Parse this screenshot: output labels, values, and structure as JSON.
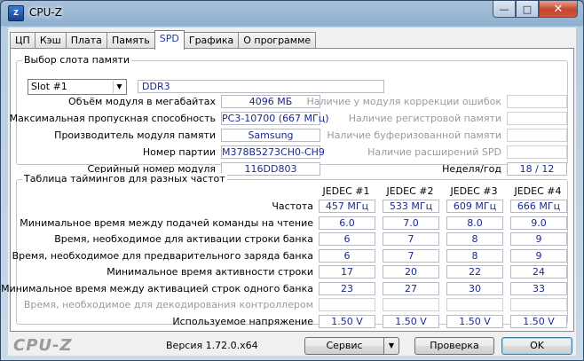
{
  "window": {
    "title": "CPU-Z",
    "app_icon_text": "Z",
    "buttons": {
      "minimize": "—",
      "maximize": "□",
      "close": "✕"
    }
  },
  "tabs": [
    "ЦП",
    "Кэш",
    "Плата",
    "Память",
    "SPD",
    "Графика",
    "О программе"
  ],
  "active_tab": "SPD",
  "slot_group": {
    "title": "Выбор слота памяти",
    "slot_value": "Slot #1",
    "memory_type": "DDR3",
    "fields_left": [
      {
        "label": "Объём модуля в мегабайтах",
        "value": "4096 МБ"
      },
      {
        "label": "Максимальная пропускная способность",
        "value": "PC3-10700 (667 МГц)"
      },
      {
        "label": "Производитель модуля памяти",
        "value": "Samsung"
      },
      {
        "label": "Номер партии",
        "value": "M378B5273CH0-CH9"
      },
      {
        "label": "Серийный номер модуля",
        "value": "116DD803"
      }
    ],
    "fields_right": [
      {
        "label": "Наличие у модуля коррекции ошибок",
        "value": "",
        "disabled": true
      },
      {
        "label": "Наличие регистровой памяти",
        "value": "",
        "disabled": true
      },
      {
        "label": "Наличие буферизованной памяти",
        "value": "",
        "disabled": true
      },
      {
        "label": "Наличие расширений SPD",
        "value": "",
        "disabled": true
      },
      {
        "label": "Неделя/год",
        "value": "18 / 12",
        "disabled": false
      }
    ]
  },
  "timings_group": {
    "title": "Таблица таймингов для разных частот",
    "columns": [
      "JEDEC #1",
      "JEDEC #2",
      "JEDEC #3",
      "JEDEC #4"
    ],
    "rows": [
      {
        "label": "Частота",
        "values": [
          "457 МГц",
          "533 МГц",
          "609 МГц",
          "666 МГц"
        ],
        "disabled": false
      },
      {
        "label": "Минимальное время между подачей команды на чтение",
        "values": [
          "6.0",
          "7.0",
          "8.0",
          "9.0"
        ],
        "disabled": false
      },
      {
        "label": "Время, необходимое для активации строки банка",
        "values": [
          "6",
          "7",
          "8",
          "9"
        ],
        "disabled": false
      },
      {
        "label": "Время, необходимое для предварительного заряда банка",
        "values": [
          "6",
          "7",
          "8",
          "9"
        ],
        "disabled": false
      },
      {
        "label": "Минимальное время активности строки",
        "values": [
          "17",
          "20",
          "22",
          "24"
        ],
        "disabled": false
      },
      {
        "label": "Минимальное время между активацией строк одного банка",
        "values": [
          "23",
          "27",
          "30",
          "33"
        ],
        "disabled": false
      },
      {
        "label": "Время, необходимое для декодирования контроллером",
        "values": [
          "",
          "",
          "",
          ""
        ],
        "disabled": true
      },
      {
        "label": "Используемое напряжение",
        "values": [
          "1.50 V",
          "1.50 V",
          "1.50 V",
          "1.50 V"
        ],
        "disabled": false
      }
    ]
  },
  "footer": {
    "logo": "CPU-Z",
    "version": "Версия 1.72.0.x64",
    "service_button": "Сервис",
    "validate_button": "Проверка",
    "ok_button": "OK"
  }
}
